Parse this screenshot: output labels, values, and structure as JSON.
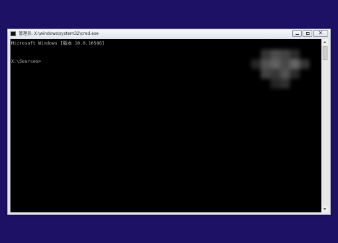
{
  "window": {
    "title": "管理员: X:\\windows\\system32\\cmd.exe",
    "icon": "cmd-icon",
    "controls": {
      "minimize": "minimize-icon",
      "maximize": "maximize-icon",
      "close_glyph": "✕"
    }
  },
  "console": {
    "lines": [
      "Microsoft Windows [版本 10.0.10586]",
      "X:\\Sources>"
    ]
  },
  "colors": {
    "desktop_background": "#1c1164",
    "console_background": "#000000",
    "console_text": "#c0c0c0"
  }
}
